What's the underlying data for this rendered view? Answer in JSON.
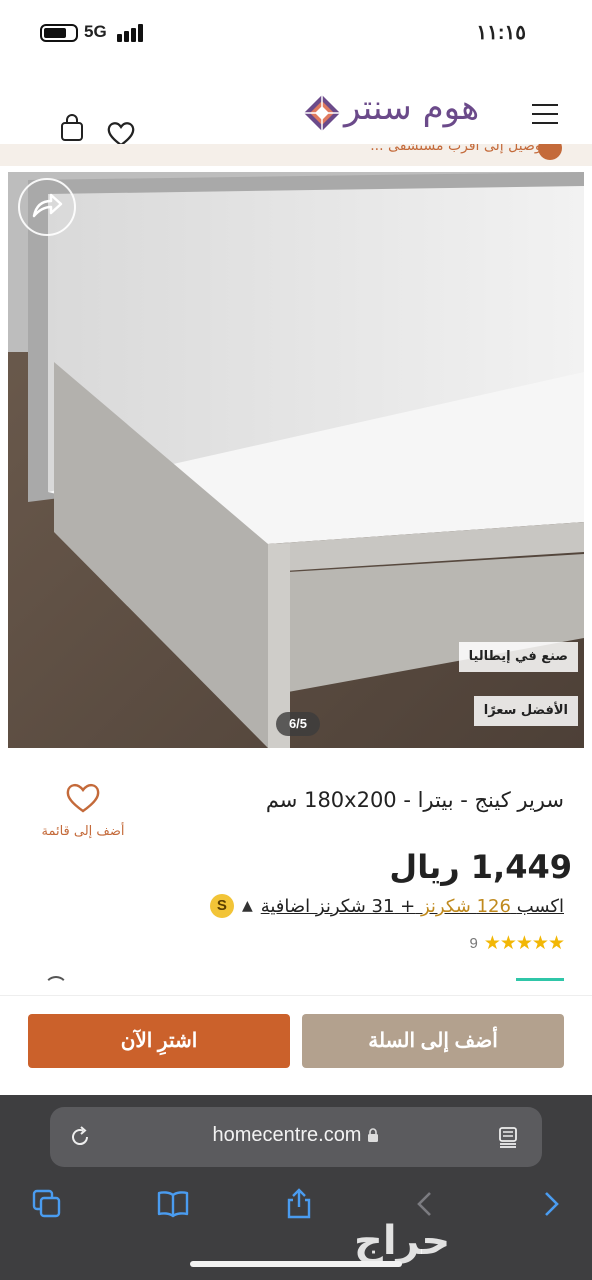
{
  "status_bar": {
    "time": "١١:١٥",
    "network": "5G"
  },
  "header": {
    "logo_text": "هوم سنتر",
    "banner_text": "توصيل إلى أقرب مستشفى ..."
  },
  "product": {
    "image_badges": [
      "صنع في إيطاليا",
      "الأفضل سعرًا"
    ],
    "image_counter": "6/5",
    "title": "سرير كينج - بيترا - 180x200 سم",
    "wishlist_label": "أضف إلى قائمة",
    "price": "1,449 ريال",
    "rewards": {
      "coin_letter": "S",
      "prefix": "اكسب",
      "points": "126 شكرنز",
      "suffix": "+ 31 شكرنز اضافية"
    },
    "rating": {
      "stars": "★★★★★",
      "review_count": "9"
    }
  },
  "actions": {
    "buy_now": "اشترِ الآن",
    "add_to_cart": "أضف إلى السلة"
  },
  "browser": {
    "url": "homecentre.com",
    "watermark": "حراج"
  },
  "colors": {
    "accent_orange": "#cb612b",
    "cart_button": "#b3a18e",
    "brand_purple": "#6b4a8a",
    "star": "#f2b705",
    "link_blue": "#4a9cf0"
  }
}
